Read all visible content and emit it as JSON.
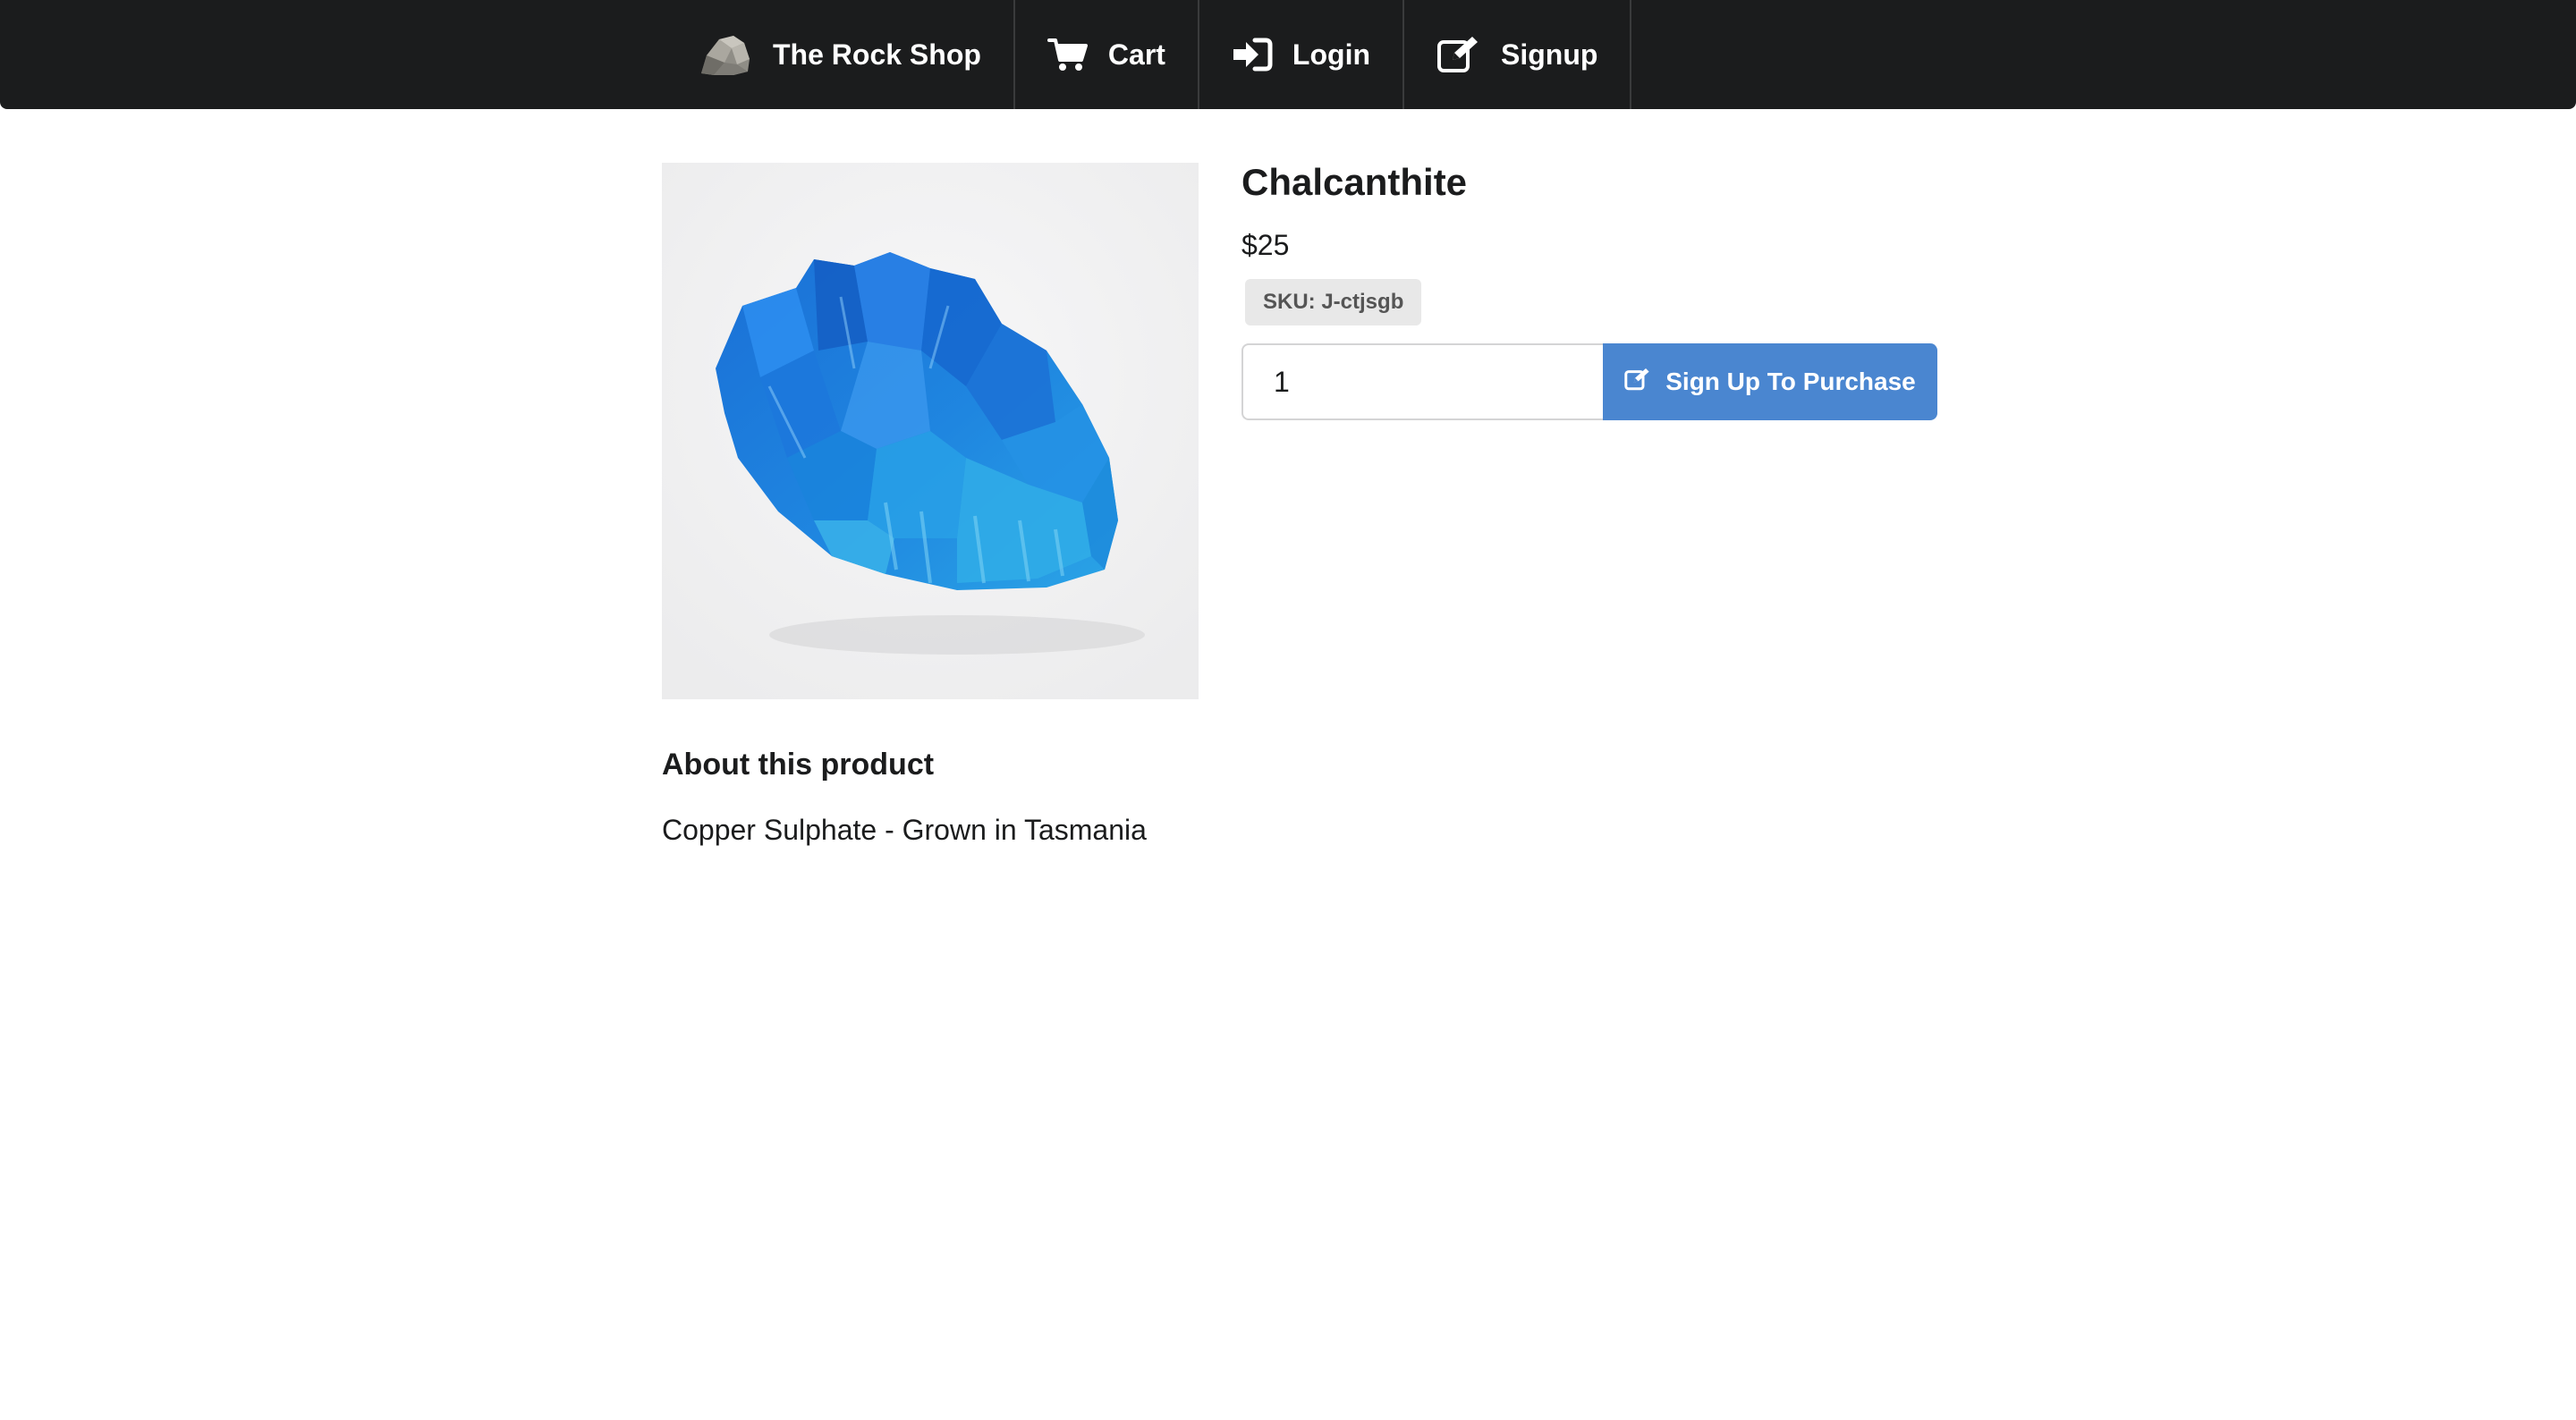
{
  "nav": {
    "brand": {
      "label": "The Rock Shop",
      "icon": "rock-logo-icon"
    },
    "items": [
      {
        "label": "Cart",
        "icon": "cart-icon"
      },
      {
        "label": "Login",
        "icon": "sign-in-icon"
      },
      {
        "label": "Signup",
        "icon": "edit-icon"
      }
    ]
  },
  "product": {
    "name": "Chalcanthite",
    "price": "$25",
    "sku": "SKU: J-ctjsgb",
    "quantity": "1",
    "purchase_button": "Sign Up To Purchase",
    "image_alt": "blue crystal cluster"
  },
  "about": {
    "title": "About this product",
    "description": "Copper Sulphate - Grown in Tasmania"
  },
  "colors": {
    "topbar": "#1b1c1d",
    "primary_button": "#4a86d0",
    "crystal": "#1f7fd8"
  }
}
